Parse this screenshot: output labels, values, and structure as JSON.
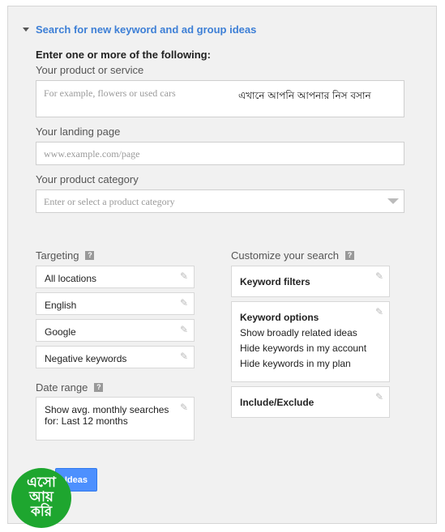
{
  "header": {
    "title": "Search for new keyword and ad group ideas"
  },
  "form": {
    "intro": "Enter one or more of the following:",
    "product": {
      "label": "Your product or service",
      "placeholder": "For example, flowers or used cars",
      "note": "এখানে আপনি আপনার নিস বসান"
    },
    "landing": {
      "label": "Your landing page",
      "placeholder": "www.example.com/page"
    },
    "category": {
      "label": "Your product category",
      "placeholder": "Enter or select a product category"
    }
  },
  "targeting": {
    "label": "Targeting",
    "help": "?",
    "items": [
      "All locations",
      "English",
      "Google",
      "Negative keywords"
    ]
  },
  "date_range": {
    "label": "Date range",
    "help": "?",
    "value": "Show avg. monthly searches for: Last 12 months"
  },
  "customize": {
    "label": "Customize your search",
    "help": "?",
    "keyword_filters": "Keyword filters",
    "keyword_options": {
      "title": "Keyword options",
      "lines": [
        "Show broadly related ideas",
        "Hide keywords in my account",
        "Hide keywords in my plan"
      ]
    },
    "include_exclude": "Include/Exclude"
  },
  "button": {
    "label": "Ideas"
  },
  "logo": {
    "lines": [
      "এসো",
      "আয়",
      "করি"
    ],
    "color": "#1ea62f"
  },
  "icons": {
    "edit": "pencil-icon",
    "expand": "triangle-down-icon",
    "help": "help-icon"
  }
}
